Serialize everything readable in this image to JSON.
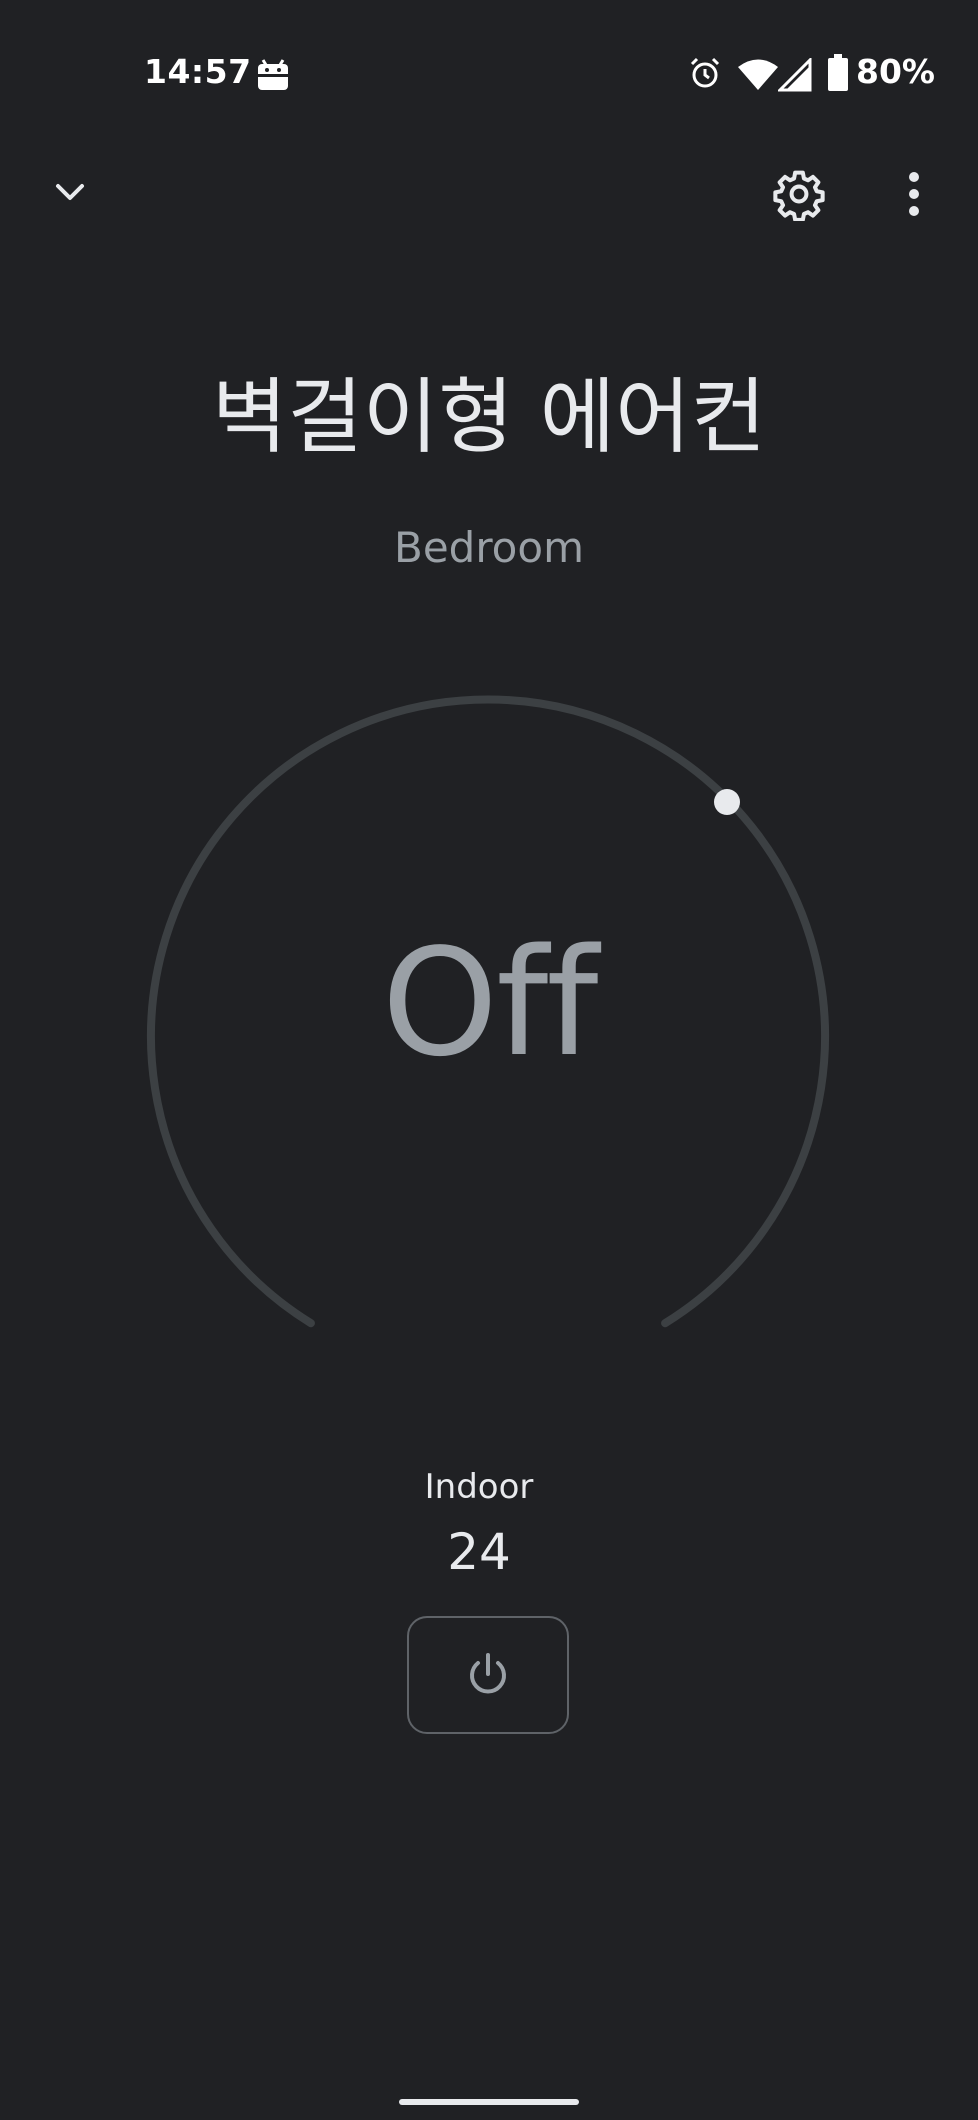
{
  "status_bar": {
    "time": "14:57",
    "battery_percent": "80%",
    "icons": [
      "android-app-icon",
      "alarm-icon",
      "wifi-icon",
      "cell-signal-icon",
      "battery-icon"
    ]
  },
  "app_bar": {
    "collapse_icon": "chevron-down-icon",
    "settings_icon": "gear-icon",
    "more_icon": "more-vert-icon"
  },
  "device": {
    "name": "벽걸이형 에어컨",
    "room": "Bedroom"
  },
  "dial": {
    "status": "Off",
    "track_color": "#3c4043",
    "handle_color": "#e8eaed"
  },
  "indoor": {
    "label": "Indoor",
    "value": "24"
  },
  "power": {
    "icon": "power-icon"
  },
  "colors": {
    "background": "#202124",
    "text_primary": "#e8eaed",
    "text_secondary": "#9aa0a6",
    "outline": "#5f6368"
  }
}
